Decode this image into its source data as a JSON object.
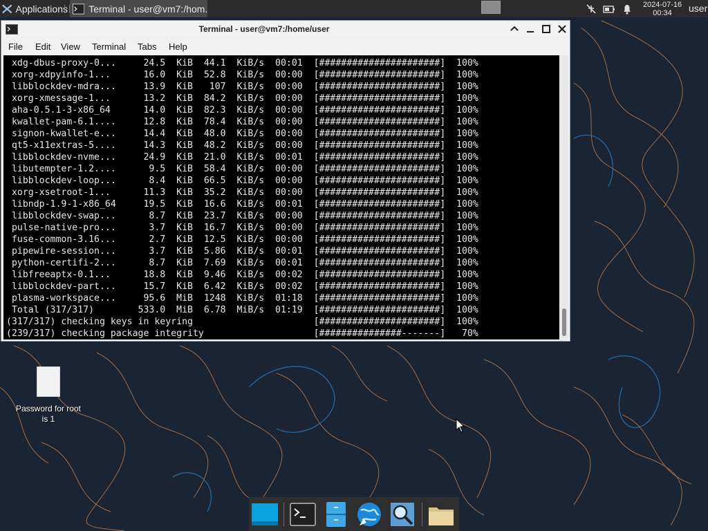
{
  "panel": {
    "apps_label": "Applications",
    "task_label": "Terminal - user@vm7:/hom...",
    "clock_date": "2024-07-16",
    "clock_time": "00:34",
    "user_label": "user"
  },
  "window": {
    "title": "Terminal - user@vm7:/home/user",
    "menu": [
      "File",
      "Edit",
      "View",
      "Terminal",
      "Tabs",
      "Help"
    ]
  },
  "terminal": {
    "lines": [
      " xdg-dbus-proxy-0...     24.5  KiB  44.1  KiB/s  00:01  [######################]  100%",
      " xorg-xdpyinfo-1...      16.0  KiB  52.8  KiB/s  00:00  [######################]  100%",
      " libblockdev-mdra...     13.9  KiB   107  KiB/s  00:00  [######################]  100%",
      " xorg-xmessage-1...      13.2  KiB  84.2  KiB/s  00:00  [######################]  100%",
      " aha-0.5.1-3-x86_64      14.0  KiB  82.3  KiB/s  00:00  [######################]  100%",
      " kwallet-pam-6.1....     12.8  KiB  78.4  KiB/s  00:00  [######################]  100%",
      " signon-kwallet-e...     14.4  KiB  48.0  KiB/s  00:00  [######################]  100%",
      " qt5-x11extras-5....     14.3  KiB  48.2  KiB/s  00:00  [######################]  100%",
      " libblockdev-nvme...     24.9  KiB  21.0  KiB/s  00:01  [######################]  100%",
      " libutempter-1.2....      9.5  KiB  58.4  KiB/s  00:00  [######################]  100%",
      " libblockdev-loop...      8.4  KiB  66.5  KiB/s  00:00  [######################]  100%",
      " xorg-xsetroot-1...      11.3  KiB  35.2  KiB/s  00:00  [######################]  100%",
      " libndp-1.9-1-x86_64     19.5  KiB  16.6  KiB/s  00:01  [######################]  100%",
      " libblockdev-swap...      8.7  KiB  23.7  KiB/s  00:00  [######################]  100%",
      " pulse-native-pro...      3.7  KiB  16.7  KiB/s  00:00  [######################]  100%",
      " fuse-common-3.16...      2.7  KiB  12.5  KiB/s  00:00  [######################]  100%",
      " pipewire-session...      3.7  KiB  5.86  KiB/s  00:01  [######################]  100%",
      " python-certifi-2...      8.7  KiB  7.69  KiB/s  00:01  [######################]  100%",
      " libfreeaptx-0.1...      18.8  KiB  9.46  KiB/s  00:02  [######################]  100%",
      " libblockdev-part...     15.7  KiB  6.42  KiB/s  00:02  [######################]  100%",
      " plasma-workspace...     95.6  MiB  1248  KiB/s  01:18  [######################]  100%",
      " Total (317/317)        533.0  MiB  6.78  MiB/s  01:19  [######################]  100%",
      "(317/317) checking keys in keyring                      [######################]  100%",
      "(239/317) checking package integrity                    [###############-------]   70%"
    ]
  },
  "desktop": {
    "file_caption": "Password for root is 1"
  },
  "dock": {
    "items": [
      "show-desktop",
      "terminal",
      "file-manager",
      "web-browser",
      "app-finder",
      "home-folder"
    ]
  },
  "colors": {
    "panel_bg": "#2b2b2b",
    "terminal_bg": "#000000",
    "terminal_fg": "#e6e6e6",
    "wallpaper_bg": "#1b2433",
    "wallpaper_line_orange": "#c9824a",
    "wallpaper_line_blue": "#2a7fbf"
  }
}
